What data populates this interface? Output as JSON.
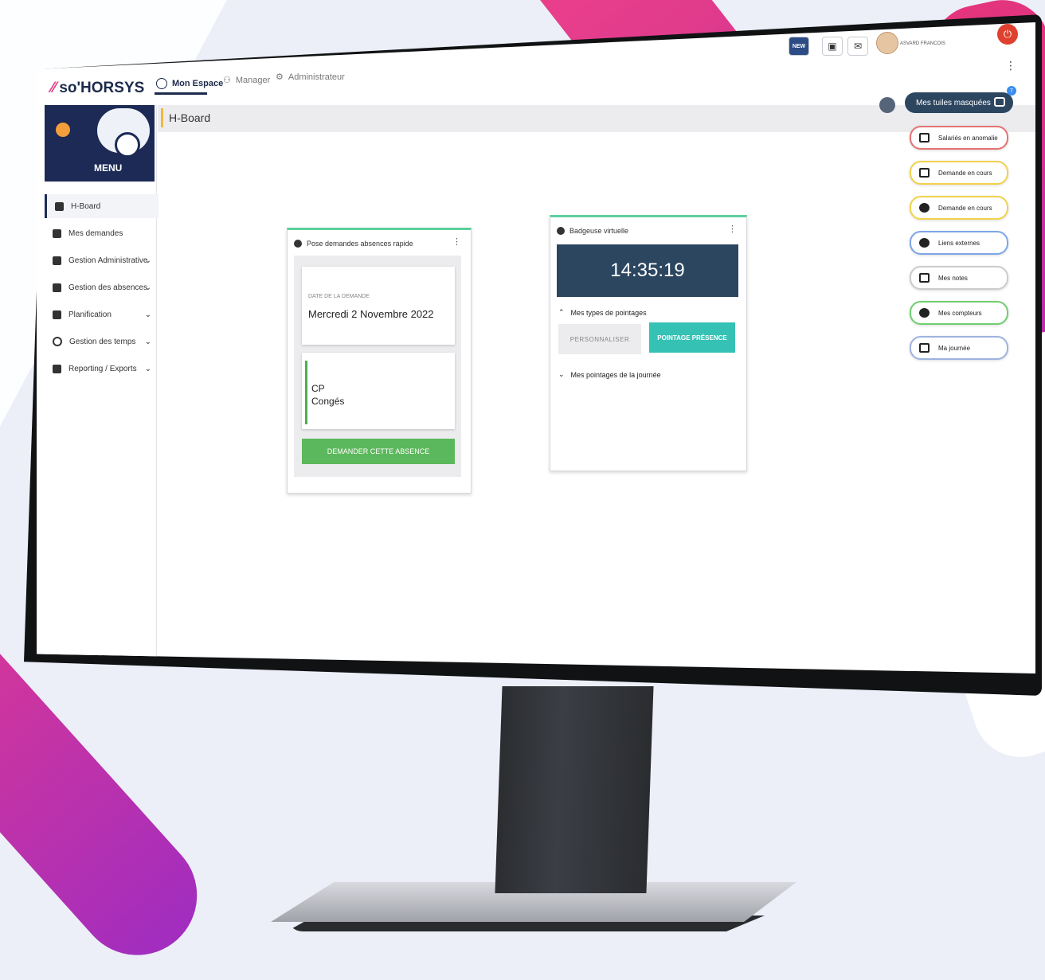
{
  "app": {
    "logo": "so'HORSYS",
    "tabs": [
      {
        "label": "Mon Espace",
        "active": true
      },
      {
        "label": "Manager",
        "active": false
      },
      {
        "label": "Administrateur",
        "active": false
      }
    ],
    "user_name": "ASVARD FRANCOIS",
    "new_badge": "NEW"
  },
  "sidebar": {
    "menu_label": "MENU",
    "items": [
      {
        "label": "H-Board",
        "icon": "dashboard-icon",
        "active": true
      },
      {
        "label": "Mes demandes",
        "icon": "requests-icon"
      },
      {
        "label": "Gestion Administrative",
        "icon": "folder-icon",
        "expandable": true
      },
      {
        "label": "Gestion des absences",
        "icon": "absence-icon",
        "expandable": true
      },
      {
        "label": "Planification",
        "icon": "calendar-icon",
        "expandable": true
      },
      {
        "label": "Gestion des temps",
        "icon": "clock-icon",
        "expandable": true
      },
      {
        "label": "Reporting / Exports",
        "icon": "print-icon",
        "expandable": true
      }
    ]
  },
  "page": {
    "title": "H-Board"
  },
  "card_absence": {
    "title": "Pose demandes absences rapide",
    "date_label": "DATE DE LA DEMANDE",
    "date_value": "Mercredi 2 Novembre 2022",
    "absence_code": "CP",
    "absence_label": "Congés",
    "button": "DEMANDER CETTE ABSENCE"
  },
  "card_badge": {
    "title": "Badgeuse virtuelle",
    "time": "14:35:19",
    "section_types": "Mes types de pointages",
    "btn_custom": "PERSONNALISER",
    "btn_presence": "POINTAGE PRÉSENCE",
    "section_day": "Mes pointages de la journée"
  },
  "right_panel": {
    "hidden_tiles_label": "Mes tuiles masquées",
    "hidden_count": "7",
    "tiles": [
      {
        "label": "Salariés en anomalie",
        "color": "#e57373",
        "icon": "list-icon"
      },
      {
        "label": "Demande en cours",
        "color": "#f2d24b",
        "icon": "bar-chart-icon"
      },
      {
        "label": "Demande en cours",
        "color": "#f2d24b",
        "icon": "pie-chart-icon"
      },
      {
        "label": "Liens externes",
        "color": "#7ea6e8",
        "icon": "link-icon"
      },
      {
        "label": "Mes notes",
        "color": "#cccccc",
        "icon": "notes-icon"
      },
      {
        "label": "Mes compteurs",
        "color": "#6fcf6f",
        "icon": "counter-icon"
      },
      {
        "label": "Ma journée",
        "color": "#9fb3e0",
        "icon": "calendar-day-icon"
      }
    ]
  },
  "colors": {
    "brand_navy": "#1c2a55",
    "accent_pink": "#e13a86",
    "green": "#5cb85c",
    "teal": "#35c2b5",
    "clock_bg": "#2c4660"
  }
}
